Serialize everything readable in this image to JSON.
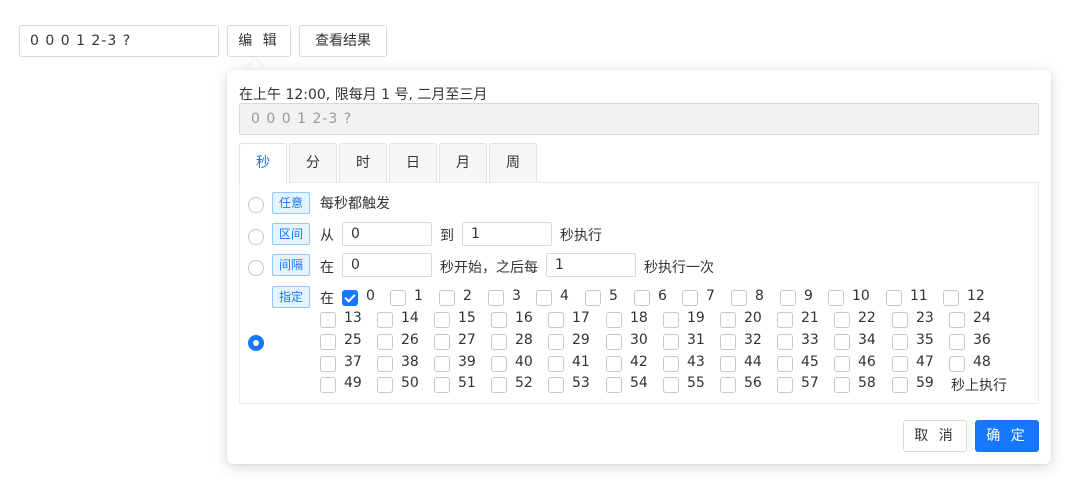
{
  "toolbar": {
    "cron_value": "0 0 0 1 2-3 ?",
    "edit_label": "编 辑",
    "view_result_label": "查看结果"
  },
  "popover": {
    "description": "在上午 12:00, 限每月 1 号, 二月至三月",
    "expression": "0 0 0 1 2-3 ?",
    "tabs": [
      "秒",
      "分",
      "时",
      "日",
      "月",
      "周"
    ],
    "active_tab": "秒",
    "options": {
      "any": {
        "tag": "任意",
        "text": "每秒都触发"
      },
      "range": {
        "tag": "区间",
        "from_label": "从",
        "from_value": "0",
        "to_label": "到",
        "to_value": "1",
        "suffix": "秒执行"
      },
      "interval": {
        "tag": "间隔",
        "at_label": "在",
        "start_value": "0",
        "middle": "秒开始，之后每",
        "step_value": "1",
        "suffix": "秒执行一次"
      },
      "specify": {
        "tag": "指定",
        "at_label": "在",
        "suffix": "秒上执行",
        "checked": [
          0
        ]
      }
    },
    "selected_option": "specify",
    "cancel_label": "取 消",
    "ok_label": "确 定"
  },
  "colors": {
    "accent": "#1677ff",
    "tag_bg": "#e6f4ff",
    "tag_border": "#91caff"
  }
}
